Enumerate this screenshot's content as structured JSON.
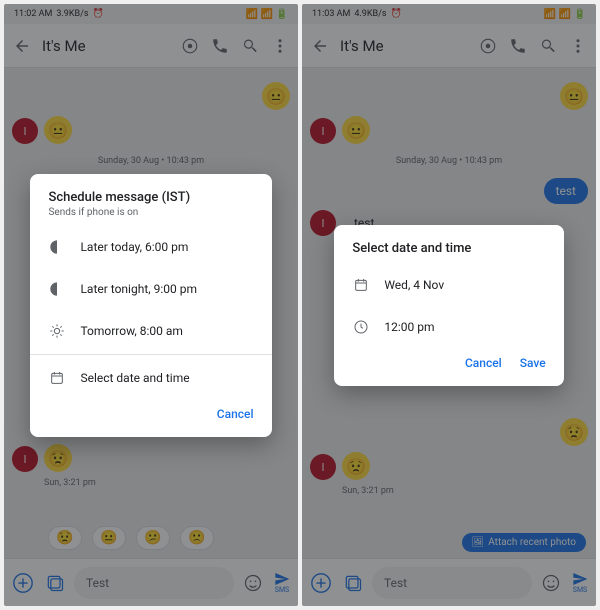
{
  "left": {
    "status": {
      "time": "11:02 AM",
      "speed": "3.9KB/s"
    },
    "header": {
      "title": "It's Me"
    },
    "timestamp": "Sunday, 30 Aug • 10:43 pm",
    "avatar_initial": "I",
    "msg_ts": "Sun, 3:21 pm",
    "compose_text": "Test",
    "send_label": "SMS",
    "dialog": {
      "title": "Schedule message (IST)",
      "subtitle": "Sends if phone is on",
      "opt1": "Later today, 6:00 pm",
      "opt2": "Later tonight, 9:00 pm",
      "opt3": "Tomorrow, 8:00 am",
      "opt4": "Select date and time",
      "cancel": "Cancel"
    }
  },
  "right": {
    "status": {
      "time": "11:03 AM",
      "speed": "4.9KB/s"
    },
    "header": {
      "title": "It's Me"
    },
    "timestamp": "Sunday, 30 Aug • 10:43 pm",
    "avatar_initial": "I",
    "bubble_out": "test",
    "bubble_in": "test",
    "msg_ts": "Sun, 3:21 pm",
    "attach": "Attach recent photo",
    "compose_text": "Test",
    "send_label": "SMS",
    "dialog": {
      "title": "Select date and time",
      "date": "Wed, 4 Nov",
      "time": "12:00 pm",
      "cancel": "Cancel",
      "save": "Save"
    }
  }
}
